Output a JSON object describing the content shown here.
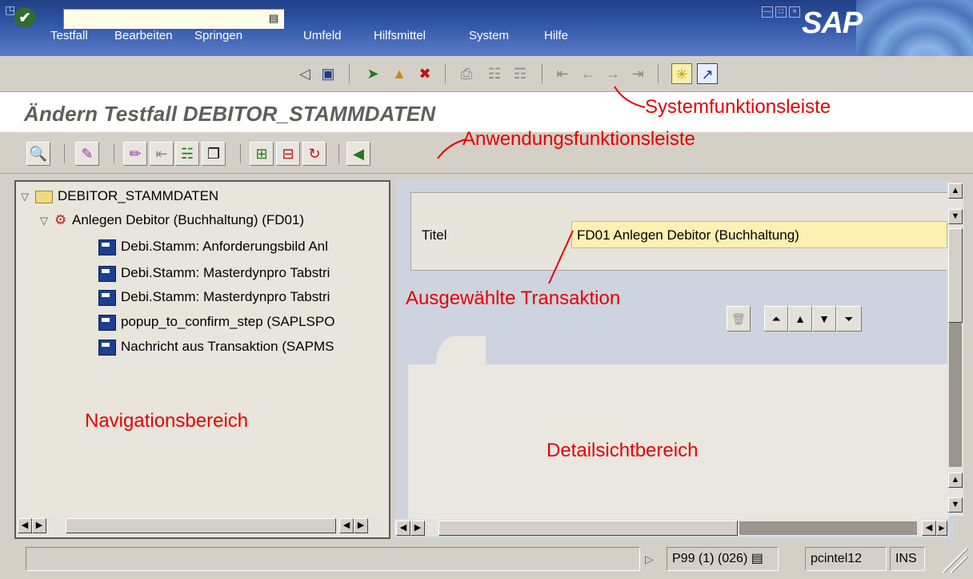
{
  "menubar": {
    "items": [
      "Testfall",
      "Bearbeiten",
      "Springen",
      "Umfeld",
      "Hilfsmittel",
      "System",
      "Hilfe"
    ],
    "logo": "SAP"
  },
  "system_toolbar": {
    "command_field": {
      "value": "",
      "placeholder": ""
    },
    "icons": [
      "enter-icon",
      "history-icon",
      "back-arrow-icon",
      "save-icon",
      "back-icon",
      "exit-icon",
      "cancel-icon",
      "print-icon",
      "find-icon",
      "find-next-icon",
      "first-page-icon",
      "previous-page-icon",
      "next-page-icon",
      "last-page-icon",
      "create-session-icon",
      "shortcut-icon"
    ]
  },
  "title": "Ändern Testfall DEBITOR_STAMMDATEN",
  "app_toolbar": {
    "icons": [
      "display-icon",
      "edit-icon",
      "change-step-icon",
      "insert-icon",
      "structure-icon",
      "copy-icon",
      "add-step-icon",
      "remove-step-icon",
      "replay-icon",
      "back-green-icon"
    ]
  },
  "navigation_tree": {
    "root": "DEBITOR_STAMMDATEN",
    "transaction": "Anlegen Debitor (Buchhaltung) (FD01)",
    "steps": [
      "Debi.Stamm: Anforderungsbild Anl",
      "Debi.Stamm: Masterdynpro Tabstri",
      "Debi.Stamm: Masterdynpro Tabstri",
      "popup_to_confirm_step (SAPLSPO",
      "Nachricht aus Transaktion (SAPMS"
    ]
  },
  "detail": {
    "titel_label": "Titel",
    "titel_value": "FD01 Anlegen Debitor (Buchhaltung)"
  },
  "annotations": {
    "system_bar": "Systemfunktionsleiste",
    "app_bar": "Anwendungsfunktionsleiste",
    "selected": "Ausgewählte Transaktion",
    "navigation": "Navigationsbereich",
    "detail": "Detailsichtbereich"
  },
  "status": {
    "system": "P99 (1) (026)",
    "server": "pcintel12",
    "mode": "INS"
  },
  "colors": {
    "menubar": "#2f55a6",
    "annotation": "#e60000",
    "input_highlight": "#fcf0b3"
  }
}
